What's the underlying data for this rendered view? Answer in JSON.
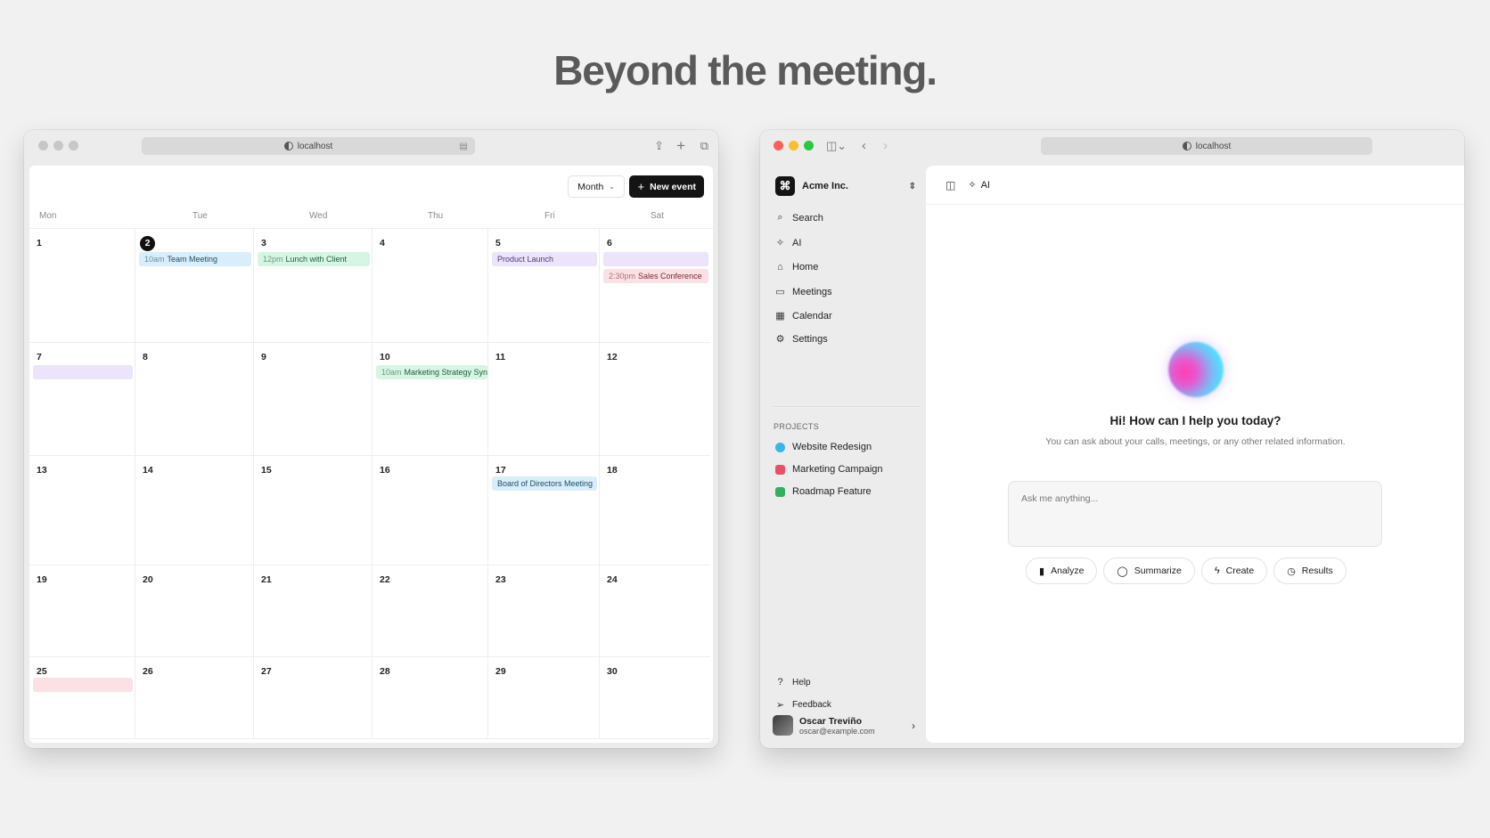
{
  "headline": "Beyond the meeting.",
  "calendar_window": {
    "url": "localhost",
    "month_button": "Month",
    "new_event_button": "New event",
    "weekdays": [
      "Mon",
      "Tue",
      "Wed",
      "Thu",
      "Fri",
      "Sat"
    ],
    "days": [
      "1",
      "2",
      "3",
      "4",
      "5",
      "6",
      "7",
      "8",
      "9",
      "10",
      "11",
      "12",
      "13",
      "14",
      "15",
      "16",
      "17",
      "18",
      "19",
      "20",
      "21",
      "22",
      "23",
      "24",
      "25",
      "26",
      "27",
      "28",
      "29",
      "30"
    ],
    "events": {
      "team_meeting": {
        "time": "10am",
        "title": "Team Meeting"
      },
      "lunch_client": {
        "time": "12pm",
        "title": "Lunch with Client"
      },
      "product_launch": {
        "title": "Product Launch"
      },
      "sales_conference": {
        "time": "2:30pm",
        "title": "Sales Conference"
      },
      "marketing_sync": {
        "time": "10am",
        "title": "Marketing Strategy Sync"
      },
      "board_meeting": {
        "title": "Board of Directors Meeting"
      }
    }
  },
  "ai_window": {
    "url": "localhost",
    "org_name": "Acme Inc.",
    "nav": [
      "Search",
      "AI",
      "Home",
      "Meetings",
      "Calendar",
      "Settings"
    ],
    "projects_label": "PROJECTS",
    "projects": [
      "Website Redesign",
      "Marketing Campaign",
      "Roadmap Feature"
    ],
    "bottom_nav": [
      "Help",
      "Feedback"
    ],
    "user": {
      "name": "Oscar Treviño",
      "email": "oscar@example.com"
    },
    "header_label": "AI",
    "greeting": "Hi! How can I help you today?",
    "subtext": "You can ask about your calls, meetings, or any other related information.",
    "input_placeholder": "Ask me anything...",
    "actions": [
      "Analyze",
      "Summarize",
      "Create",
      "Results"
    ]
  }
}
